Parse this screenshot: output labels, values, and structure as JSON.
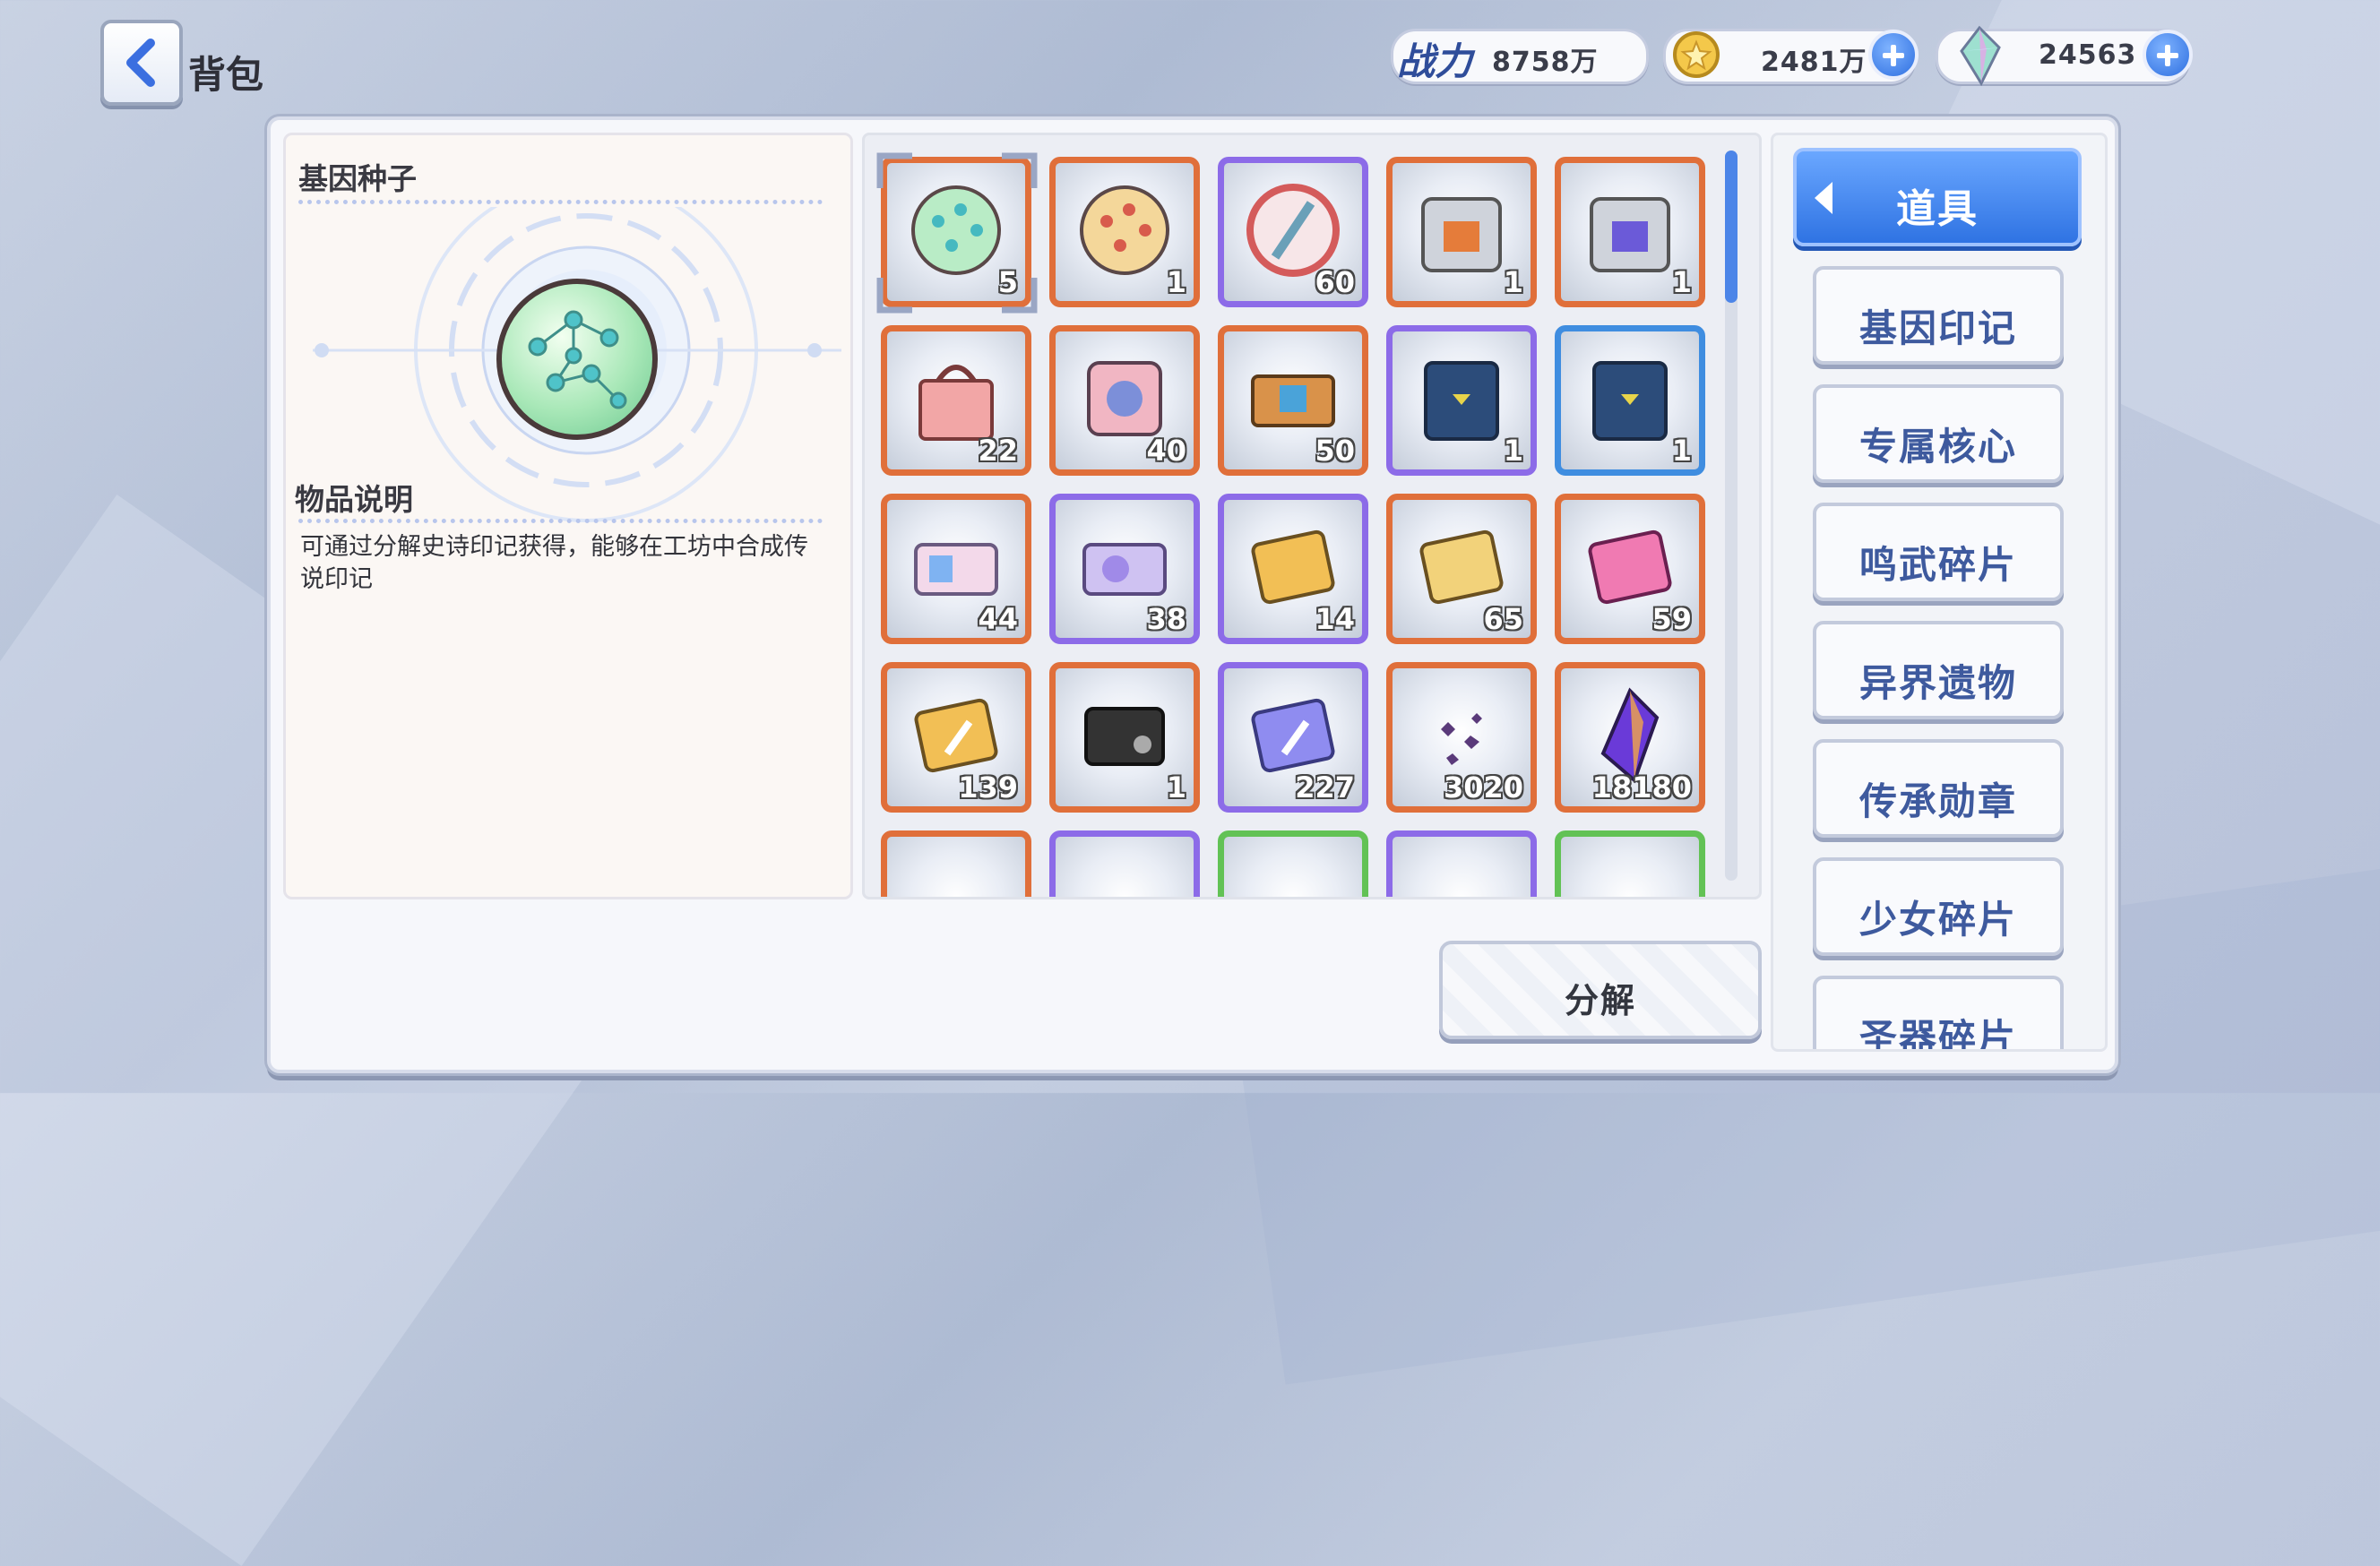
{
  "header": {
    "title": "背包",
    "power_label": "战力",
    "power_value": "8758万",
    "gold_value": "2481万",
    "gem_value": "24563"
  },
  "detail": {
    "item_name": "基因种子",
    "desc_title": "物品说明",
    "desc_text": "可通过分解史诗印记获得，能够在工坊中合成传说印记"
  },
  "grid": {
    "items": [
      {
        "count": "5",
        "icon": "gene-seed-green-icon"
      },
      {
        "count": "1",
        "icon": "gene-seed-gold-icon"
      },
      {
        "count": "60",
        "icon": "dna-orb-icon"
      },
      {
        "count": "1",
        "icon": "orange-chip-box-icon"
      },
      {
        "count": "1",
        "icon": "purple-chip-box-icon"
      },
      {
        "count": "22",
        "icon": "gift-box-icon"
      },
      {
        "count": "40",
        "icon": "pink-crate-icon"
      },
      {
        "count": "50",
        "icon": "wooden-crate-icon"
      },
      {
        "count": "1",
        "icon": "supply-box-icon"
      },
      {
        "count": "1",
        "icon": "supply-box-blue-icon"
      },
      {
        "count": "44",
        "icon": "outfit-ticket-icon"
      },
      {
        "count": "38",
        "icon": "smile-ticket-icon"
      },
      {
        "count": "14",
        "icon": "dna-card-gold-icon"
      },
      {
        "count": "65",
        "icon": "map-card-icon"
      },
      {
        "count": "59",
        "icon": "dna-card-pink-icon"
      },
      {
        "count": "139",
        "icon": "sword-card-gold-icon"
      },
      {
        "count": "1",
        "icon": "black-card-icon"
      },
      {
        "count": "227",
        "icon": "sword-card-purple-icon"
      },
      {
        "count": "3020",
        "icon": "crystal-shards-icon"
      },
      {
        "count": "18180",
        "icon": "purple-crystal-icon"
      }
    ]
  },
  "categories": {
    "active": "道具",
    "items": [
      "基因印记",
      "专属核心",
      "鸣武碎片",
      "异界遗物",
      "传承勋章",
      "少女碎片",
      "圣器碎片"
    ]
  },
  "actions": {
    "decompose": "分解"
  }
}
